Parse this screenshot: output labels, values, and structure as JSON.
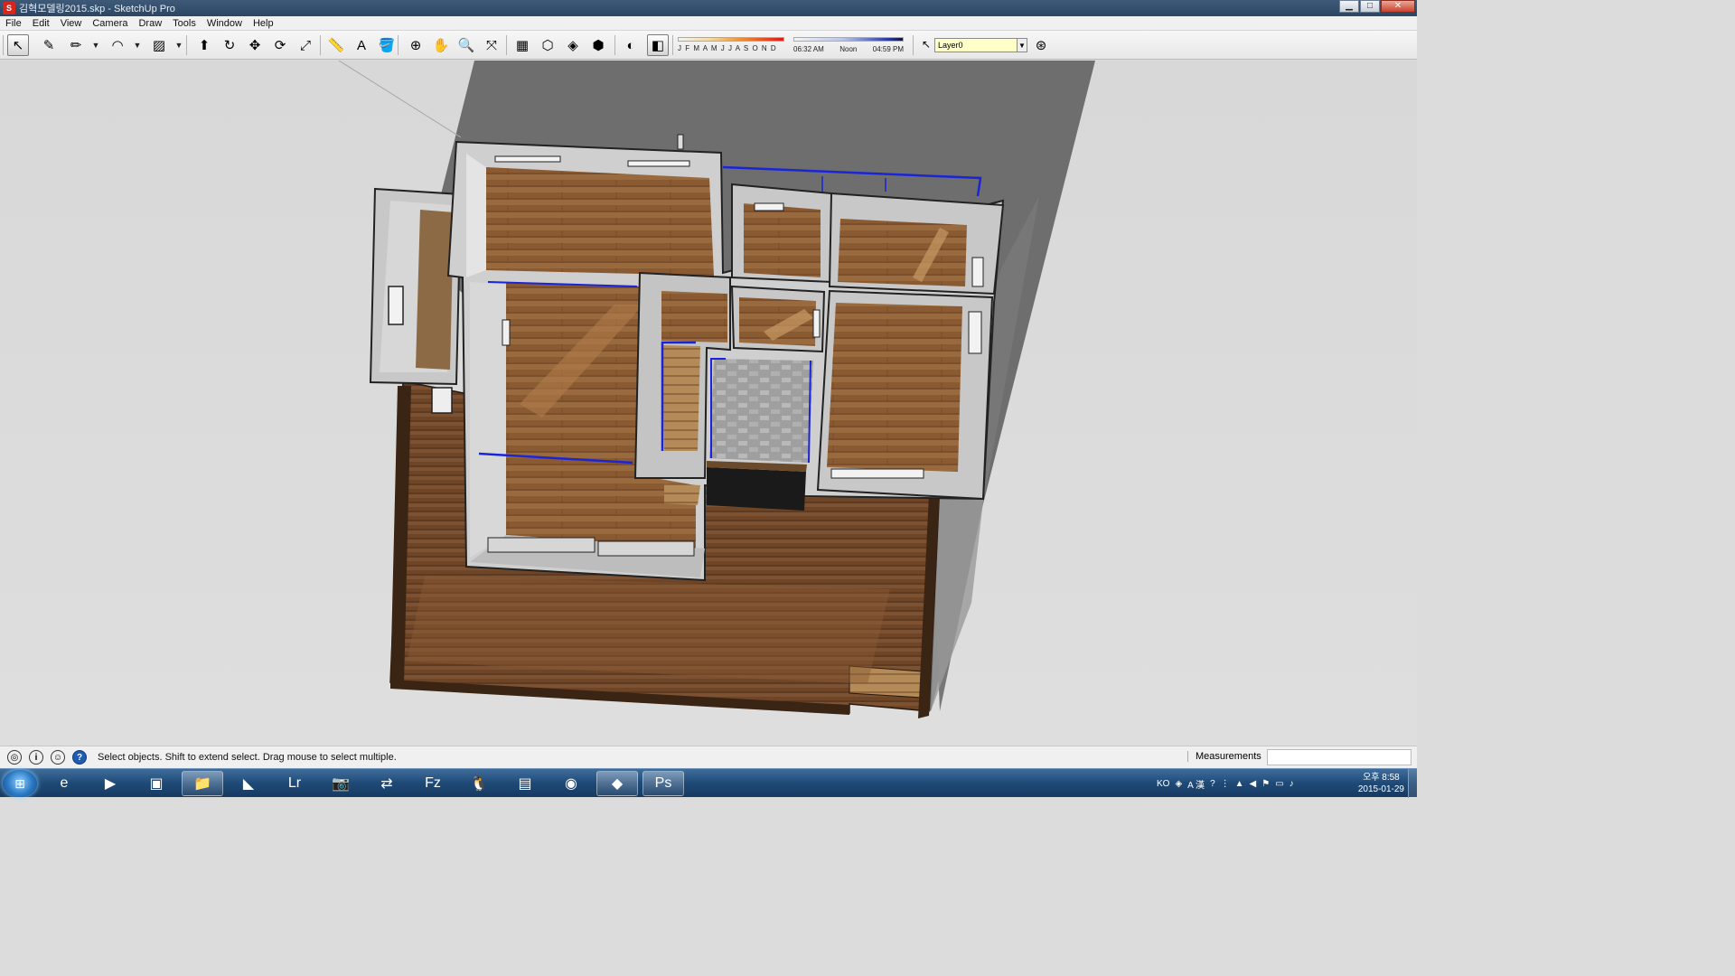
{
  "window": {
    "title": "김혁모델링2015.skp - SketchUp Pro",
    "app_icon": "sketchup-icon",
    "minimize": "▁",
    "maximize": "□",
    "close": "✕"
  },
  "menu": [
    "File",
    "Edit",
    "View",
    "Camera",
    "Draw",
    "Tools",
    "Window",
    "Help"
  ],
  "toolbar": {
    "tools": [
      {
        "name": "select-tool-icon",
        "glyph": "↖",
        "active": true
      },
      {
        "name": "eraser-tool-icon",
        "glyph": "✎"
      },
      {
        "name": "pencil-line-tool-icon",
        "glyph": "✏"
      },
      {
        "name": "line-dropdown-icon",
        "glyph": "▼"
      },
      {
        "name": "arc-tool-icon",
        "glyph": "◠"
      },
      {
        "name": "arc-dropdown-icon",
        "glyph": "▼"
      },
      {
        "name": "rectangle-tool-icon",
        "glyph": "▨"
      },
      {
        "name": "shape-dropdown-icon",
        "glyph": "▼"
      },
      {
        "name": "push-pull-tool-icon",
        "glyph": "⬆"
      },
      {
        "name": "follow-me-tool-icon",
        "glyph": "↻"
      },
      {
        "name": "move-tool-icon",
        "glyph": "✥"
      },
      {
        "name": "rotate-tool-icon",
        "glyph": "⟳"
      },
      {
        "name": "scale-tool-icon",
        "glyph": "⤢"
      },
      {
        "name": "tape-measure-tool-icon",
        "glyph": "📏"
      },
      {
        "name": "text-tool-icon",
        "glyph": "A"
      },
      {
        "name": "paint-bucket-tool-icon",
        "glyph": "🪣"
      },
      {
        "name": "orbit-tool-icon",
        "glyph": "⊕"
      },
      {
        "name": "pan-tool-icon",
        "glyph": "✋"
      },
      {
        "name": "zoom-tool-icon",
        "glyph": "🔍"
      },
      {
        "name": "zoom-extents-tool-icon",
        "glyph": "⤧"
      },
      {
        "name": "warehouse-icon",
        "glyph": "▦"
      },
      {
        "name": "share-model-icon",
        "glyph": "⬡"
      },
      {
        "name": "components-icon",
        "glyph": "◈"
      },
      {
        "name": "extension-warehouse-icon",
        "glyph": "⬢"
      },
      {
        "name": "shadows-toggle-icon",
        "glyph": "◐"
      },
      {
        "name": "fog-toggle-icon",
        "glyph": "◧",
        "active": true
      }
    ],
    "months_label": "J F M A M J J A S O N D",
    "time_start": "06:32 AM",
    "time_mid": "Noon",
    "time_end": "04:59 PM",
    "layer": "Layer0",
    "layer_manager_icon": "layer-manager-icon"
  },
  "status": {
    "message": "Select objects. Shift to extend select. Drag mouse to select multiple.",
    "measurements_label": "Measurements",
    "measurements_value": ""
  },
  "taskbar": {
    "apps": [
      {
        "name": "internet-explorer-icon",
        "glyph": "e"
      },
      {
        "name": "media-player-icon",
        "glyph": "▶"
      },
      {
        "name": "photo-viewer-icon",
        "glyph": "▣"
      },
      {
        "name": "file-explorer-icon",
        "glyph": "📁",
        "open": true
      },
      {
        "name": "visual-studio-icon",
        "glyph": "◣"
      },
      {
        "name": "lightroom-icon",
        "glyph": "Lr"
      },
      {
        "name": "camera-icon",
        "glyph": "📷"
      },
      {
        "name": "network-tool-icon",
        "glyph": "⇄"
      },
      {
        "name": "filezilla-icon",
        "glyph": "Fz"
      },
      {
        "name": "qq-icon",
        "glyph": "🐧"
      },
      {
        "name": "archive-icon",
        "glyph": "▤"
      },
      {
        "name": "chrome-icon",
        "glyph": "◉"
      },
      {
        "name": "sketchup-taskbar-icon",
        "glyph": "◆",
        "open": true
      },
      {
        "name": "photoshop-icon",
        "glyph": "Ps",
        "open": true
      }
    ],
    "tray_lang": "KO",
    "tray_ime": "A 漢",
    "clock_time": "오후 8:58",
    "clock_date": "2015-01-29"
  }
}
